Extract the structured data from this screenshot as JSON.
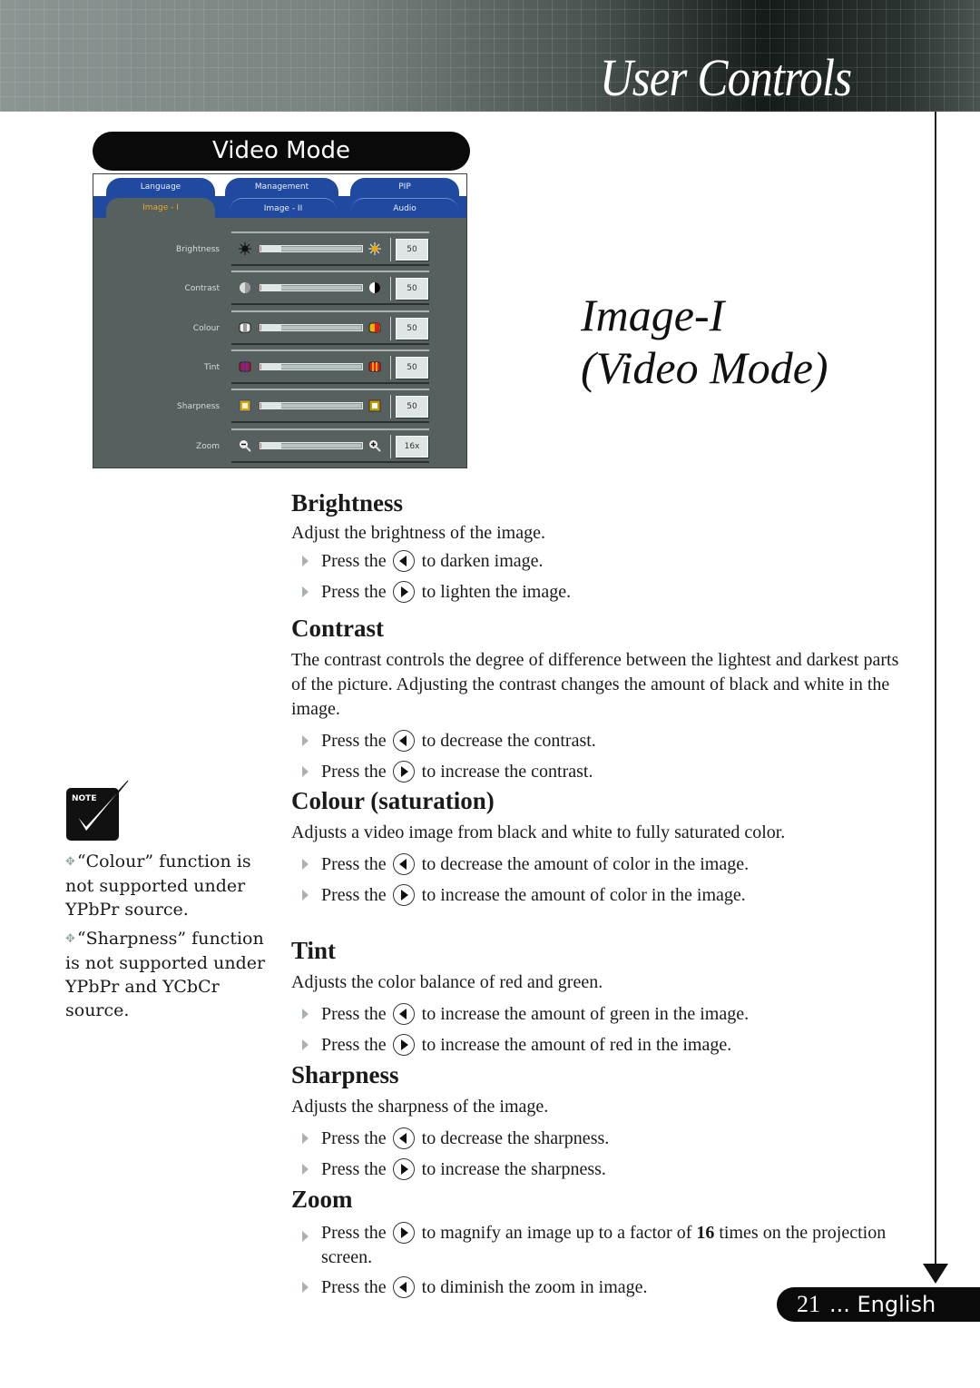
{
  "header": {
    "title": "User Controls"
  },
  "mode_pill": {
    "label": "Video Mode"
  },
  "osd": {
    "tabs_top": [
      "Language",
      "Management",
      "PIP"
    ],
    "tabs_bottom": [
      "Image - I",
      "Image - II",
      "Audio"
    ],
    "active_tab": "Image - I",
    "active_color": "#e6a82a",
    "rows": [
      {
        "label": "Brightness",
        "value": "50",
        "level": 0.2,
        "icon_left": "sun-dark-icon",
        "icon_right": "sun-bright-icon"
      },
      {
        "label": "Contrast",
        "value": "50",
        "level": 0.2,
        "icon_left": "contrast-low-icon",
        "icon_right": "contrast-high-icon"
      },
      {
        "label": "Colour",
        "value": "50",
        "level": 0.2,
        "icon_left": "colour-gray-icon",
        "icon_right": "colour-saturated-icon"
      },
      {
        "label": "Tint",
        "value": "50",
        "level": 0.2,
        "icon_left": "tint-green-icon",
        "icon_right": "tint-red-icon"
      },
      {
        "label": "Sharpness",
        "value": "50",
        "level": 0.2,
        "icon_left": "sharpness-soft-icon",
        "icon_right": "sharpness-sharp-icon"
      },
      {
        "label": "Zoom",
        "value": "16x",
        "level": 0.2,
        "icon_left": "zoom-out-icon",
        "icon_right": "zoom-in-icon"
      }
    ]
  },
  "page_title": {
    "line1": "Image-I",
    "line2": "(Video Mode)"
  },
  "sections": {
    "brightness": {
      "heading": "Brightness",
      "desc": "Adjust the brightness of the image.",
      "b1_pre": "Press the",
      "b1_post": "to darken image.",
      "b2_pre": "Press the",
      "b2_post": "to lighten the image."
    },
    "contrast": {
      "heading": "Contrast",
      "desc": "The contrast controls the degree of difference between the lightest and darkest parts of the picture. Adjusting the contrast changes the amount of black and white in the image.",
      "b1_pre": "Press the",
      "b1_post": "to decrease the contrast.",
      "b2_pre": "Press the",
      "b2_post": "to increase the contrast."
    },
    "colour": {
      "heading": "Colour (saturation)",
      "desc": "Adjusts a video image from black and white to fully saturated color.",
      "b1_pre": "Press the",
      "b1_post": "to decrease the amount of color in the image.",
      "b2_pre": "Press the",
      "b2_post": "to increase the amount of color in the image."
    },
    "tint": {
      "heading": "Tint",
      "desc": "Adjusts the color balance of red and green.",
      "b1_pre": "Press the",
      "b1_post": "to increase the amount of green in the image.",
      "b2_pre": "Press the",
      "b2_post": "to increase the amount of red  in the image."
    },
    "sharpness": {
      "heading": "Sharpness",
      "desc": "Adjusts the sharpness of the image.",
      "b1_pre": "Press the",
      "b1_post": "to decrease the sharpness.",
      "b2_pre": "Press the",
      "b2_post": "to increase the sharpness."
    },
    "zoom": {
      "heading": "Zoom",
      "b1_pre": "Press the",
      "b1_mid": "to magnify an image up to a factor of",
      "b1_bold": "16",
      "b1_post": "times on the projection screen.",
      "b2_pre": "Press the",
      "b2_post": "to diminish the zoom in image."
    }
  },
  "note": {
    "badge": "NOTE",
    "items": [
      "“Colour” function is not supported under YPbPr source.",
      "“Sharpness” function is not supported under YPbPr and YCbCr source."
    ]
  },
  "footer": {
    "page_number": "21",
    "language": "... English"
  }
}
